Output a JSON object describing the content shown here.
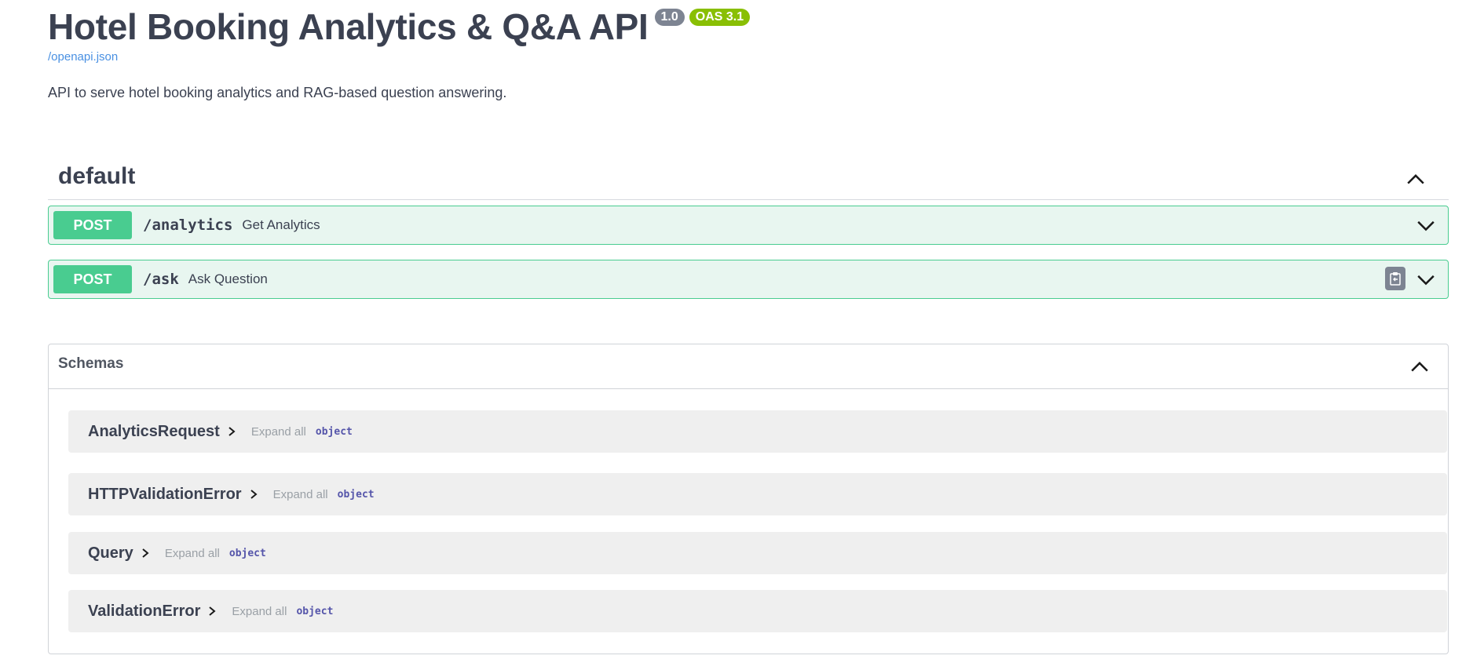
{
  "header": {
    "title": "Hotel Booking Analytics & Q&A API",
    "version_badge": "1.0",
    "oas_badge": "OAS 3.1",
    "spec_link": "/openapi.json",
    "description": "API to serve hotel booking analytics and RAG-based question answering."
  },
  "tag": {
    "name": "default",
    "operations": [
      {
        "method": "POST",
        "path": "/analytics",
        "summary": "Get Analytics"
      },
      {
        "method": "POST",
        "path": "/ask",
        "summary": "Ask Question"
      }
    ]
  },
  "schemas": {
    "title": "Schemas",
    "expand_label": "Expand all",
    "items": [
      {
        "name": "AnalyticsRequest",
        "type": "object"
      },
      {
        "name": "HTTPValidationError",
        "type": "object"
      },
      {
        "name": "Query",
        "type": "object"
      },
      {
        "name": "ValidationError",
        "type": "object"
      }
    ]
  },
  "colors": {
    "post_method": "#49cc90",
    "post_background": "#e8f6f0",
    "oas_badge": "#89bf04",
    "version_badge": "#7d8492",
    "link": "#4990e2"
  },
  "icons": {
    "tag_toggle": "chevron-up-icon",
    "operation_toggle": "chevron-down-icon",
    "copy": "clipboard-icon",
    "schema_expand": "chevron-right-icon"
  }
}
